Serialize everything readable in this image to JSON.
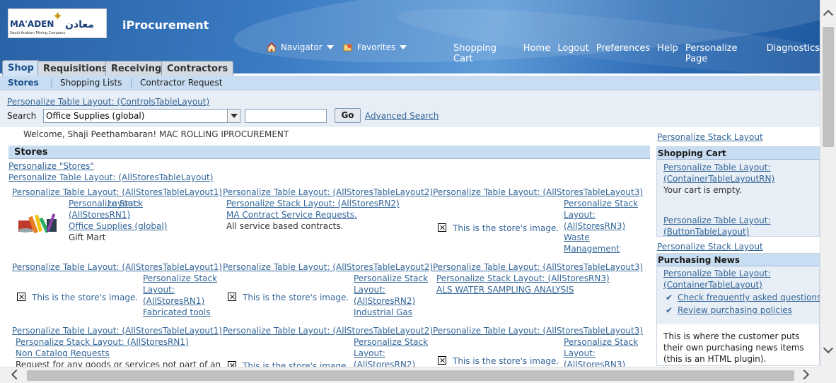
{
  "header": {
    "logo_text": "MA'ADEN",
    "logo_arabic": "معادن",
    "logo_sub": "Saudi Arabian Mining Company",
    "app_title": "iProcurement",
    "navigator": "Navigator",
    "favorites": "Favorites",
    "global_links": [
      "Shopping Cart",
      "Home",
      "Logout",
      "Preferences",
      "Help",
      "Personalize Page",
      "Diagnostics"
    ]
  },
  "tabs": [
    "Shop",
    "Requisitions",
    "Receiving",
    "Contractors"
  ],
  "subtabs": [
    "Stores",
    "Shopping Lists",
    "Contractor Request"
  ],
  "search": {
    "personalize": "Personalize Table Layout: (ControlsTableLayout)",
    "label": "Search",
    "selected": "Office Supplies (global)",
    "value": "",
    "go": "Go",
    "advanced": "Advanced Search"
  },
  "welcome": "Welcome, Shaji Peethambaran! MAC ROLLING IPROCUREMENT",
  "stores": {
    "header": "Stores",
    "pers_stores": "Personalize \"Stores\"",
    "pers_all": "Personalize Table Layout: (AllStoresTableLayout)",
    "col_layouts": [
      "Personalize Table Layout: (AllStoresTableLayout1)",
      "Personalize Table Layout: (AllStoresTableLayout2)",
      "Personalize Table Layout: (AllStoresTableLayout3)"
    ],
    "image_alt": "This is the store's image.",
    "stack_rn1_full": "Personalize Stack Layout: (AllStoresRN1)",
    "stack_rn2_full": "Personalize Stack Layout: (AllStoresRN2)",
    "stack_rn3_full": "Personalize Stack Layout: (AllStoresRN3)",
    "stack_word_a": "Personalize Stack",
    "stack_word_b": "Layout:",
    "rn1": "(AllStoresRN1)",
    "rn2": "(AllStoresRN2)",
    "rn3": "(AllStoresRN3)",
    "rows": [
      {
        "c1": {
          "name": "Office Supplies (global)",
          "desc": "Gift Mart"
        },
        "c2": {
          "name": "MA Contract Service Requests.",
          "desc": "All service based contracts."
        },
        "c3": {
          "name_a": "Waste",
          "name_b": "Management"
        }
      },
      {
        "c1": {
          "name": "Fabricated tools"
        },
        "c2": {
          "name": "Industrial Gas"
        },
        "c3": {
          "name": "ALS WATER SAMPLING ANALYSIS"
        }
      },
      {
        "c1": {
          "name": "Non Catalog Requests",
          "desc": "Request for any goods or services not part of an"
        }
      }
    ]
  },
  "right": {
    "pers_stack_1": "Personalize Stack Layout",
    "cart_header": "Shopping Cart",
    "cart_layout_a": "Personalize Table Layout:",
    "cart_layout_b": "(ContainerTableLayoutRN)",
    "cart_empty": "Your cart is empty.",
    "btn_layout_a": "Personalize Table Layout:",
    "btn_layout_b": "(ButtonTableLayout)",
    "pers_stack_2": "Personalize Stack Layout",
    "news_header": "Purchasing News",
    "news_layout_a": "Personalize Table Layout:",
    "news_layout_b": "(ContainerTableLayout)",
    "news_links": [
      "Check frequently asked questions",
      "Review purchasing policies"
    ],
    "news_plugin_1": "This is where the customer puts",
    "news_plugin_2": "their own purchasing news items",
    "news_plugin_3": "(this is an HTML plugin)."
  },
  "colors": {
    "header_blue": "#2a62a6",
    "link": "#336699",
    "section_bg": "#c8ddf2"
  },
  "icons": {
    "navigator": "home-icon",
    "favorites": "favorites-icon",
    "check": "checkmark-icon",
    "broken_image": "broken-image-icon"
  }
}
